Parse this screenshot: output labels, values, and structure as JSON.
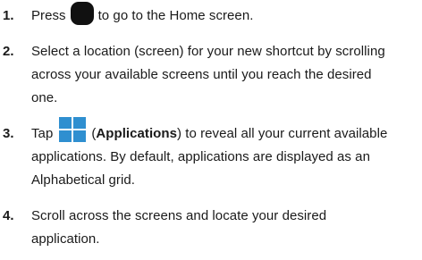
{
  "steps": [
    {
      "number": "1.",
      "before": "Press",
      "icon": "home-key-icon",
      "after": "to go to the Home screen."
    },
    {
      "number": "2.",
      "lines": [
        "Select a location (screen) for your new shortcut by scrolling",
        "across your available screens until you reach the desired",
        "one."
      ]
    },
    {
      "number": "3.",
      "before": "Tap",
      "icon": "applications-grid-icon",
      "paren_open": "(",
      "bold": "Applications",
      "after": ") to reveal all your current available",
      "lines": [
        "applications. By default, applications are displayed as an",
        "Alphabetical grid."
      ]
    },
    {
      "number": "4.",
      "lines": [
        "Scroll across the screens and locate your desired",
        "application."
      ]
    }
  ],
  "colors": {
    "text": "#1a1a1a",
    "home_key": "#111111",
    "apps_icon": "#2f8fd0"
  }
}
